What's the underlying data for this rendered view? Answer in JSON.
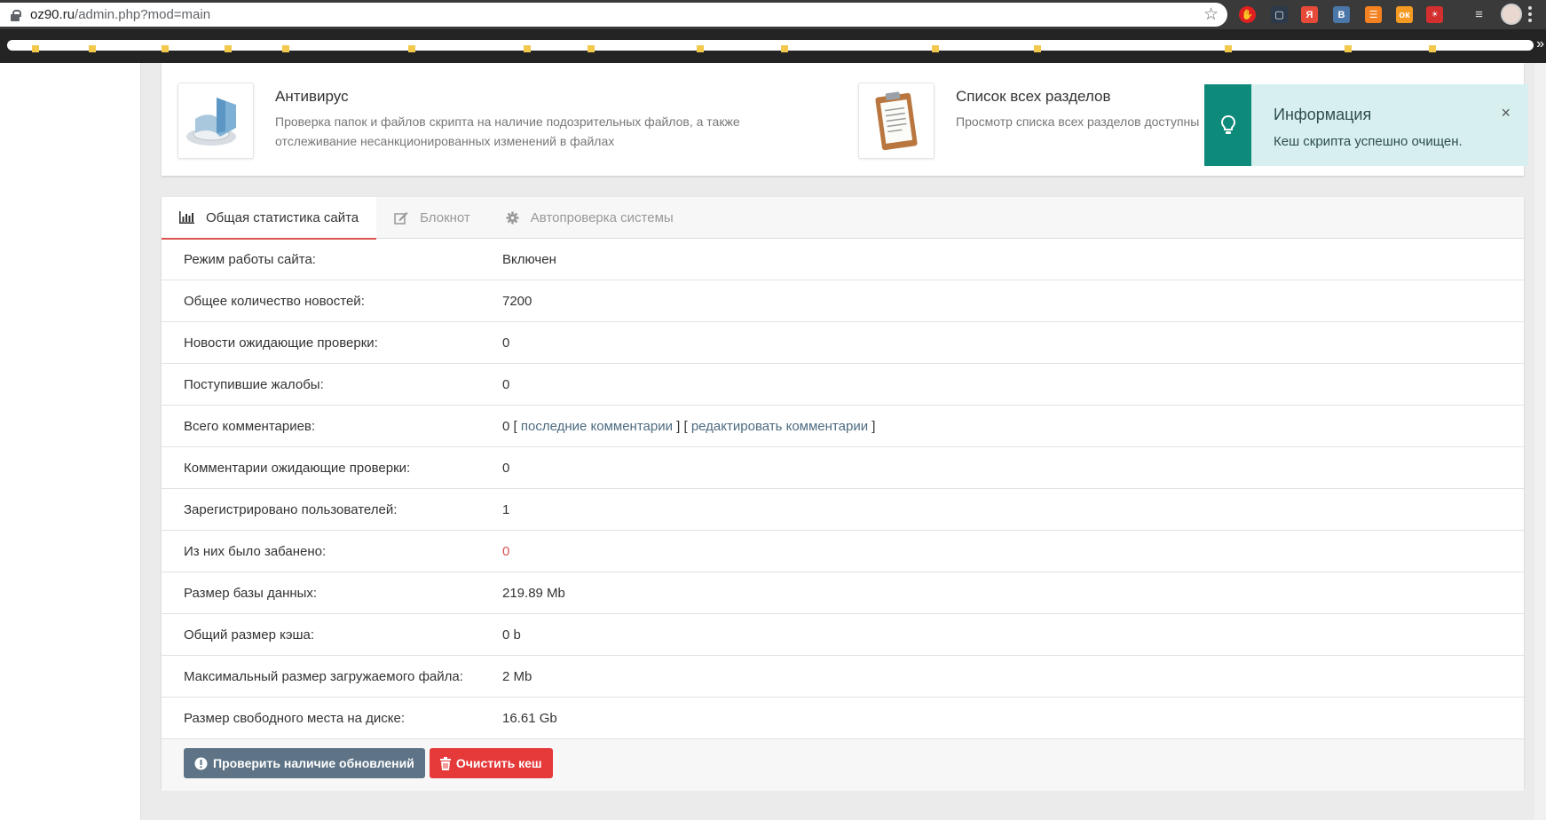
{
  "browser": {
    "url_host": "oz90.ru",
    "url_path": "/admin.php?mod=main"
  },
  "modules": [
    {
      "title": "Антивирус",
      "desc": "Проверка папок и файлов скрипта на наличие подозрительных файлов, а также отслеживание несанкционированных изменений в файлах"
    },
    {
      "title": "Список всех разделов",
      "desc": "Просмотр списка всех разделов доступны"
    }
  ],
  "alert": {
    "title": "Информация",
    "message": "Кеш скрипта успешно очищен.",
    "close": "×"
  },
  "tabs": [
    {
      "label": "Общая статистика сайта",
      "icon": "bar-chart-icon"
    },
    {
      "label": "Блокнот",
      "icon": "edit-icon"
    },
    {
      "label": "Автопроверка системы",
      "icon": "gear-icon"
    }
  ],
  "stats": {
    "mode_label": "Режим работы сайта:",
    "mode_value": "Включен",
    "news_label": "Общее количество новостей:",
    "news_value": "7200",
    "pending_news_label": "Новости ожидающие проверки:",
    "pending_news_value": "0",
    "complaints_label": "Поступившие жалобы:",
    "complaints_value": "0",
    "comments_label": "Всего комментариев:",
    "comments_value": "0",
    "comments_link_last": "последние комментарии",
    "comments_link_edit": "редактировать комментарии",
    "pending_comments_label": "Комментарии ожидающие проверки:",
    "pending_comments_value": "0",
    "users_label": "Зарегистрировано пользователей:",
    "users_value": "1",
    "banned_label": "Из них было забанено:",
    "banned_value": "0",
    "db_label": "Размер базы данных:",
    "db_value": "219.89 Mb",
    "cache_label": "Общий размер кэша:",
    "cache_value": "0 b",
    "upload_label": "Максимальный размер загружаемого файла:",
    "upload_value": "2 Mb",
    "disk_label": "Размер свободного места на диске:",
    "disk_value": "16.61 Gb"
  },
  "buttons": {
    "check_updates": "Проверить наличие обновлений",
    "clear_cache": "Очистить кеш"
  },
  "colors": {
    "accent_red": "#d9534f",
    "alert_teal": "#0e8a7b",
    "button_gray": "#5e7486"
  }
}
